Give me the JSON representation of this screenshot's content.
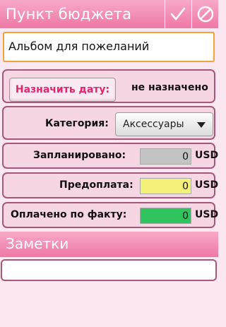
{
  "header": {
    "title": "Пункт бюджета",
    "confirm_icon": "checkmark-icon",
    "cancel_icon": "cancel-circle-icon"
  },
  "item_name": {
    "value": "Альбом для пожеланий"
  },
  "date": {
    "button_label": "Назначить дату:",
    "value": "не назначено"
  },
  "category": {
    "label": "Категория:",
    "selected": "Аксессуары"
  },
  "planned": {
    "label": "Запланировано:",
    "value": "0",
    "currency": "USD",
    "color": "#c4c4c4"
  },
  "prepaid": {
    "label": "Предоплата:",
    "value": "0",
    "currency": "USD",
    "color": "#f5f07a"
  },
  "paid": {
    "label": "Оплачено по факту:",
    "value": "0",
    "currency": "USD",
    "color": "#2fc45e"
  },
  "notes": {
    "title": "Заметки",
    "value": ""
  },
  "colors": {
    "accent": "#ee78a6",
    "border": "#a4587a",
    "button_text": "#e5246d"
  }
}
